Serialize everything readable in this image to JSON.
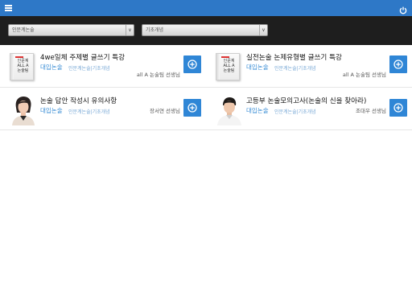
{
  "header": {
    "menu_icon": "hamburger-menu-icon",
    "refresh_icon": "power-refresh-icon",
    "bar_color": "#2e78c7"
  },
  "filters": {
    "primary_select": "인문계논술",
    "secondary_select": "기초개념",
    "arrow_glyph": "∨"
  },
  "accent_color": "#2f86d6",
  "courses": [
    {
      "title": "4we일체 주제별 글쓰기 특강",
      "category": "대입논술",
      "subcategory": "인문계논술|기초개념",
      "teacher": "all A 논술팀 선생님",
      "thumb_type": "book",
      "book_text": [
        "인문계",
        "ALL A",
        "논술팀"
      ]
    },
    {
      "title": "실전논술 논제유형별 글쓰기 특강",
      "category": "대입논술",
      "subcategory": "인문계논술|기초개념",
      "teacher": "all A 논술팀 선생님",
      "thumb_type": "book",
      "book_text": [
        "인문계",
        "ALL A",
        "논술팀"
      ]
    },
    {
      "title": "논술 답안 작성시 유의사항",
      "category": "대입논술",
      "subcategory": "인문계논술|기초개념",
      "teacher": "장서연 선생님",
      "thumb_type": "photo-woman"
    },
    {
      "title": "고등부 논술모의고사(논술의 신을 찾아라)",
      "category": "대입논술",
      "subcategory": "인문계논술|기초개념",
      "teacher": "조대우 선생님",
      "thumb_type": "photo-man"
    }
  ]
}
